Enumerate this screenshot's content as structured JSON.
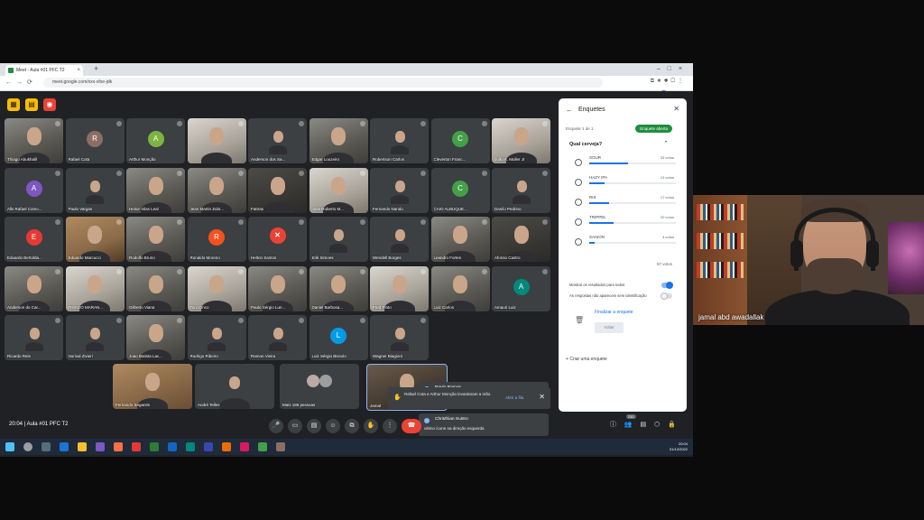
{
  "browser": {
    "tab_title": "Meet - Aula #01 PFC T2",
    "url": "meet.google.com/xxx-xfxe-jdk"
  },
  "participants": [
    {
      "name": "Thiago Abukhalil",
      "type": "cam"
    },
    {
      "name": "Rafael Cota",
      "type": "avatar",
      "letter": "R",
      "color": "#8d6e63"
    },
    {
      "name": "Arthur Monção",
      "type": "avatar",
      "letter": "A",
      "color": "#7cb342"
    },
    {
      "name": "",
      "type": "cam-light"
    },
    {
      "name": "Anderson dos Sa...",
      "type": "cam-small"
    },
    {
      "name": "Edgar Louzeiro",
      "type": "cam"
    },
    {
      "name": "Robertson Carlos",
      "type": "cam-small"
    },
    {
      "name": "Cleverton Franc...",
      "type": "avatar",
      "letter": "C",
      "color": "#43a047"
    },
    {
      "name": "João A. Muller Jr",
      "type": "cam-light"
    },
    {
      "name": "Alls Rafael Como...",
      "type": "avatar",
      "letter": "A",
      "color": "#7e57c2"
    },
    {
      "name": "Paulo Vargas",
      "type": "cam-small"
    },
    {
      "name": "Heitor Vilas Leal",
      "type": "cam"
    },
    {
      "name": "Jean Martin Zubr...",
      "type": "cam"
    },
    {
      "name": "Fattras",
      "type": "cam-dark"
    },
    {
      "name": "Jose Roberto M...",
      "type": "cam-light"
    },
    {
      "name": "Fernando Nando",
      "type": "cam-small"
    },
    {
      "name": "CAIO ALBUQUE...",
      "type": "avatar",
      "letter": "C",
      "color": "#43a047"
    },
    {
      "name": "Danilo Pedrino",
      "type": "cam-small"
    },
    {
      "name": "Eduardo Bertolda...",
      "type": "avatar",
      "letter": "E",
      "color": "#e53935"
    },
    {
      "name": "Eduardo Marcucci",
      "type": "cam-wood"
    },
    {
      "name": "Rodolfo Bruno",
      "type": "cam"
    },
    {
      "name": "Ronaldo Moreno",
      "type": "avatar",
      "letter": "R",
      "color": "#f4511e"
    },
    {
      "name": "Helton Santos",
      "type": "ex"
    },
    {
      "name": "Erik Simoes",
      "type": "cam-small"
    },
    {
      "name": "Wendell Borges",
      "type": "cam-small"
    },
    {
      "name": "Leandro Fortes",
      "type": "cam"
    },
    {
      "name": "Afonso Castro",
      "type": "cam-dark"
    },
    {
      "name": "Anderson do Car...",
      "type": "cam"
    },
    {
      "name": "THIAGO MARAN...",
      "type": "cam-light"
    },
    {
      "name": "Gilberto Viana",
      "type": "cam"
    },
    {
      "name": "Toni Cinco",
      "type": "cam-light"
    },
    {
      "name": "Paulo Sérgio Lun...",
      "type": "cam"
    },
    {
      "name": "Daniel Barbosa...",
      "type": "cam"
    },
    {
      "name": "Fred Pinto",
      "type": "cam-light"
    },
    {
      "name": "Luiz Carlos",
      "type": "cam"
    },
    {
      "name": "Amauri Luiz",
      "type": "avatar",
      "letter": "A",
      "color": "#00897b"
    },
    {
      "name": "Ricardo Reis",
      "type": "cam-small"
    },
    {
      "name": "Norival Zivieri",
      "type": "cam-small"
    },
    {
      "name": "Joao Batista Lac...",
      "type": "cam"
    },
    {
      "name": "Rodrigo Ribeiro",
      "type": "cam-small"
    },
    {
      "name": "Ramon Vieira",
      "type": "cam-small"
    },
    {
      "name": "Luiz Sérgio Bissolo",
      "type": "avatar",
      "letter": "L",
      "color": "#039be5"
    },
    {
      "name": "Wagner Biagioni",
      "type": "cam-small"
    }
  ],
  "bottom_row": [
    {
      "name": "Fernando Segantin",
      "type": "cam-wood"
    },
    {
      "name": "André Telles",
      "type": "cam-small"
    },
    {
      "name": "Mais 186 pessoas",
      "type": "more"
    },
    {
      "name": "Jamal",
      "type": "cam"
    }
  ],
  "poll": {
    "title": "Enquetes",
    "subtitle": "Enquete 1 de 1",
    "status": "Enquete aberta",
    "question": "Qual cerveja?",
    "options": [
      {
        "label": "SOUR",
        "votes": "33 votos",
        "fraction": 0.45
      },
      {
        "label": "HAZY IPA",
        "votes": "13 votos",
        "fraction": 0.18
      },
      {
        "label": "RIS",
        "votes": "17 votos",
        "fraction": 0.23
      },
      {
        "label": "TRIPPEL",
        "votes": "20 votos",
        "fraction": 0.28
      },
      {
        "label": "SAISON",
        "votes": "4 votos",
        "fraction": 0.06
      }
    ],
    "total": "87 votos",
    "toggle1": "Mostrar os resultados para todos",
    "toggle2": "As respostas não aparecem sem identificação",
    "finish": "Finalizar a enquete",
    "back": "Voltar",
    "create": "Criar uma enquete"
  },
  "notifications": [
    {
      "sender": "Paulo Ramos",
      "text": "Clica nos 3 pontinhos e das adicionais atividades"
    },
    {
      "sender": "Christhian Sustro",
      "text": "ultimo ícone na direção esquerda"
    }
  ],
  "hand_notice": {
    "text": "Rafael Cota e Arthur Monção levantaram a mão.",
    "action": "Abrir a fila"
  },
  "meeting": {
    "time": "20:04",
    "title": "Aula #01 PFC T2",
    "participant_badge": "230"
  },
  "taskbar": {
    "time": "20:04",
    "date": "01/12/2022"
  },
  "webcam": {
    "name": "jamal abd awadallak"
  }
}
